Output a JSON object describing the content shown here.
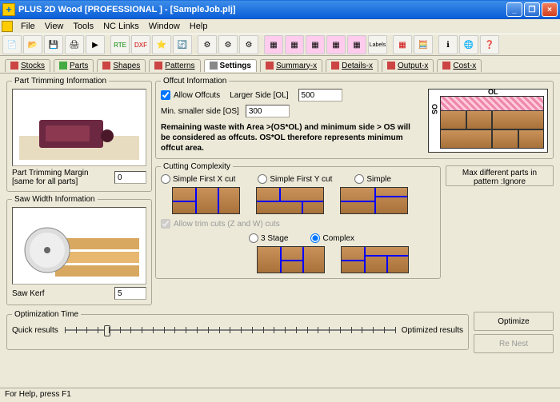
{
  "title": "PLUS 2D Wood [PROFESSIONAL ] - [SampleJob.plj]",
  "menu": [
    "File",
    "View",
    "Tools",
    "NC Links",
    "Window",
    "Help"
  ],
  "tabs": [
    {
      "label": "Stocks"
    },
    {
      "label": "Parts"
    },
    {
      "label": "Shapes"
    },
    {
      "label": "Patterns"
    },
    {
      "label": "Settings"
    },
    {
      "label": "Summary-x"
    },
    {
      "label": "Details-x"
    },
    {
      "label": "Output-x"
    },
    {
      "label": "Cost-x"
    }
  ],
  "partTrimming": {
    "legend": "Part Trimming Information",
    "marginLabel": "Part Trimming Margin [same for all parts]",
    "marginValue": "0"
  },
  "sawWidth": {
    "legend": "Saw Width Information",
    "kerfLabel": "Saw Kerf",
    "kerfValue": "5"
  },
  "offcut": {
    "legend": "Offcut Information",
    "allowLabel": "Allow Offcuts",
    "largerLabel": "Larger Side [OL]",
    "largerValue": "500",
    "minLabel": "Min. smaller side [OS]",
    "minValue": "300",
    "note": "Remaining waste with Area >(OS*OL) and minimum side > OS will be considered as offcuts. OS*OL therefore represents minimum offcut area.",
    "diagOL": "OL",
    "diagOS": "OS"
  },
  "cutting": {
    "legend": "Cutting Complexity",
    "opts": {
      "sfx": "Simple First X cut",
      "sfy": "Simple First Y cut",
      "simple": "Simple",
      "stage3": "3 Stage",
      "complex": "Complex"
    },
    "trimLabel": "Allow trim cuts (Z and W) cuts",
    "maxPartsBtn": "Max different parts in pattern :Ignore"
  },
  "optim": {
    "legend": "Optimization Time",
    "quick": "Quick results",
    "opt": "Optimized results",
    "optimizeBtn": "Optimize",
    "renestBtn": "Re Nest"
  },
  "status": "For Help, press F1"
}
